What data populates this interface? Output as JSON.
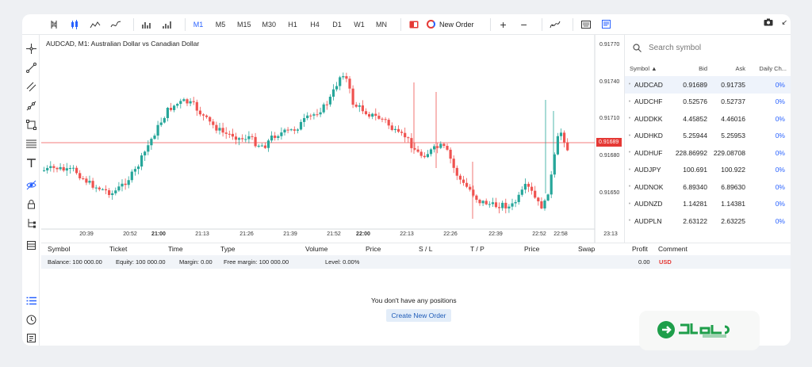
{
  "toolbar": {
    "timeframes": [
      "M1",
      "M5",
      "M15",
      "M30",
      "H1",
      "H4",
      "D1",
      "W1",
      "MN"
    ],
    "active_timeframe": "M1",
    "new_order_label": "New Order",
    "icons": [
      "candles-type-icon",
      "bars-icon",
      "indicators-icon",
      "plus-icon",
      "minus-icon",
      "camera-icon"
    ]
  },
  "chart": {
    "title": "AUDCAD, M1: Australian Dollar vs Canadian Dollar",
    "current_price": "0.91689",
    "price_ticks": [
      "0.91770",
      "0.91740",
      "0.91710",
      "0.91680",
      "0.91650"
    ],
    "time_ticks": [
      "20:39",
      "20:52",
      "21:00",
      "21:13",
      "21:26",
      "21:39",
      "21:52",
      "22:00",
      "22:13",
      "22:26",
      "22:39",
      "22:52",
      "22:58",
      "23:13"
    ],
    "colors": {
      "up": "#26a69a",
      "down": "#ef5350",
      "price_line": "#ef5350"
    }
  },
  "symbols": {
    "search_placeholder": "Search symbol",
    "headers": {
      "symbol": "Symbol ▲",
      "bid": "Bid",
      "ask": "Ask",
      "change": "Daily Ch..."
    },
    "rows": [
      {
        "symbol": "AUDCAD",
        "bid": "0.91689",
        "ask": "0.91735",
        "change": "0%"
      },
      {
        "symbol": "AUDCHF",
        "bid": "0.52576",
        "ask": "0.52737",
        "change": "0%"
      },
      {
        "symbol": "AUDDKK",
        "bid": "4.45852",
        "ask": "4.46016",
        "change": "0%"
      },
      {
        "symbol": "AUDHKD",
        "bid": "5.25944",
        "ask": "5.25953",
        "change": "0%"
      },
      {
        "symbol": "AUDHUF",
        "bid": "228.86992",
        "ask": "229.08708",
        "change": "0%"
      },
      {
        "symbol": "AUDJPY",
        "bid": "100.691",
        "ask": "100.922",
        "change": "0%"
      },
      {
        "symbol": "AUDNOK",
        "bid": "6.89340",
        "ask": "6.89630",
        "change": "0%"
      },
      {
        "symbol": "AUDNZD",
        "bid": "1.14281",
        "ask": "1.14381",
        "change": "0%"
      },
      {
        "symbol": "AUDPLN",
        "bid": "2.63122",
        "ask": "2.63225",
        "change": "0%"
      }
    ]
  },
  "positions": {
    "columns": [
      "Symbol",
      "Ticket",
      "Time",
      "Type",
      "Volume",
      "Price",
      "S / L",
      "T / P",
      "Price",
      "Swap",
      "Profit",
      "Comment"
    ],
    "balance": "Balance: 100 000.00",
    "equity": "Equity: 100 000.00",
    "margin": "Margin: 0.00",
    "free_margin": "Free margin: 100 000.00",
    "level": "Level: 0.00%",
    "profit": "0.00",
    "currency": "USD",
    "empty_message": "You don't have any positions",
    "create_order_label": "Create New Order"
  }
}
